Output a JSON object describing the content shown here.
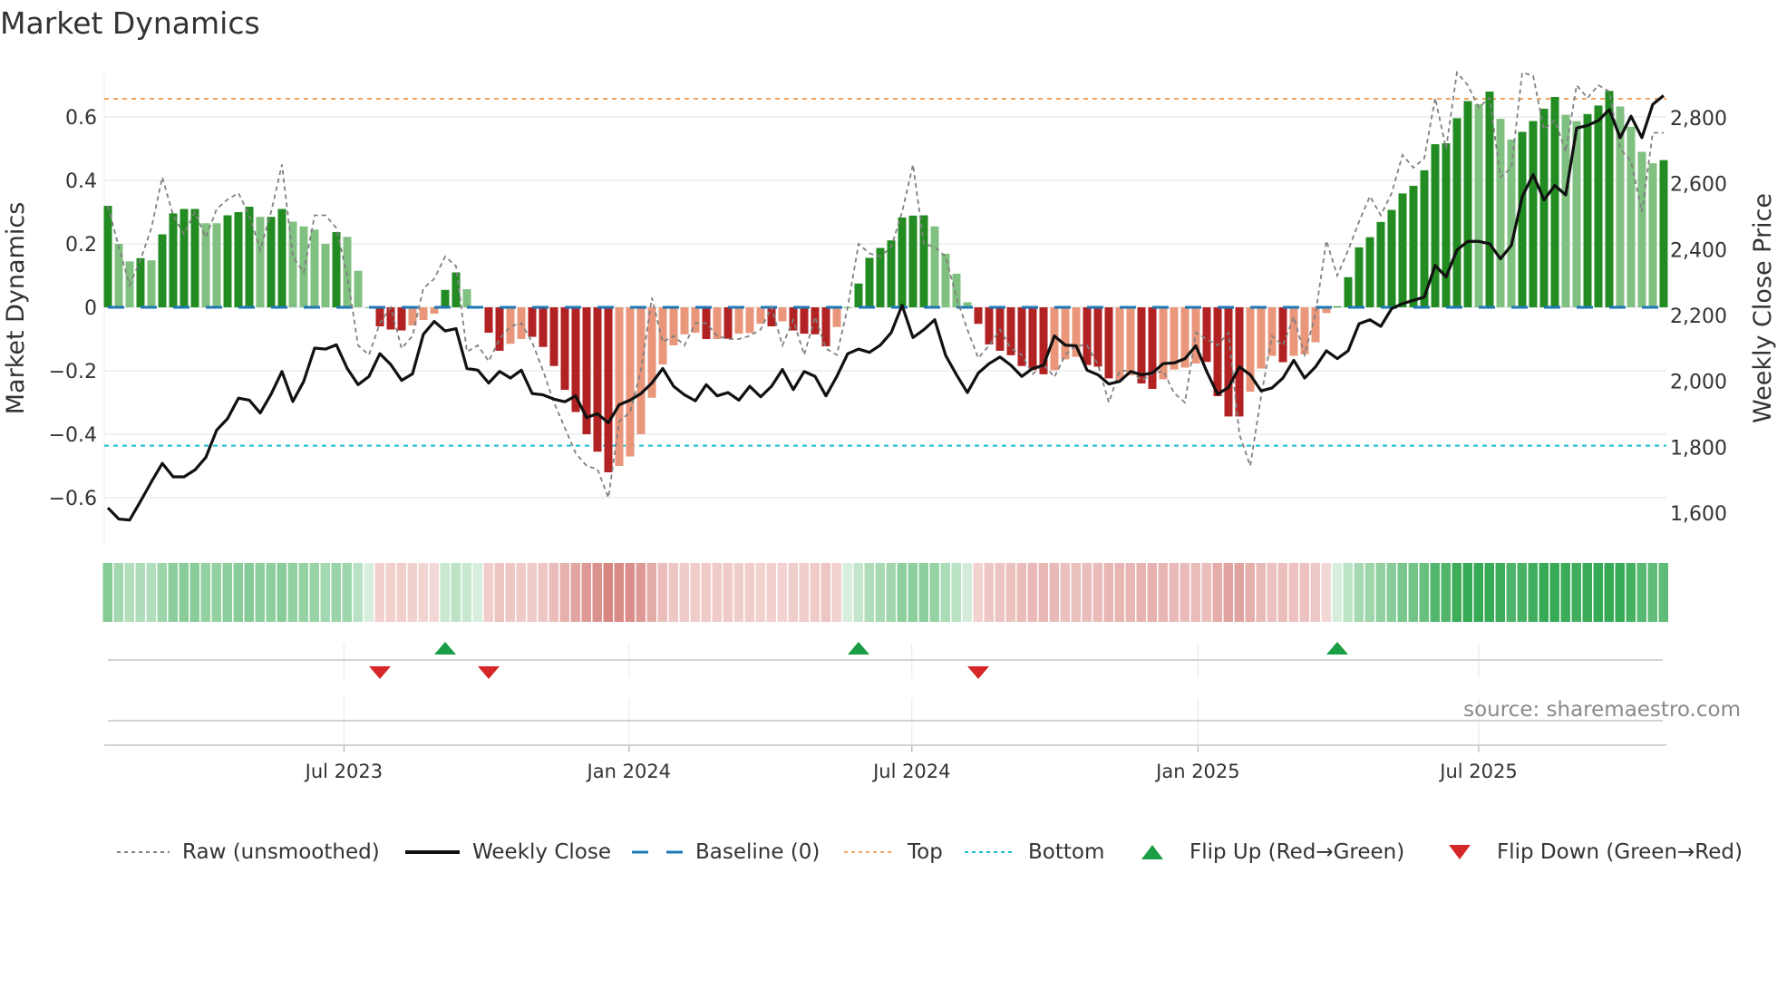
{
  "title": "Market Dynamics",
  "source": "source: sharemaestro.com",
  "colors": {
    "up_strong": "#228b22",
    "up_weak": "#80c080",
    "down_strong": "#b22222",
    "down_weak": "#e9967a",
    "baseline": "#1f77b4",
    "top": "#f4a460",
    "bottom": "#17becf",
    "raw": "#808080",
    "close": "#111111",
    "flip_up": "#1a9e45",
    "flip_down": "#d62728"
  },
  "chart_data": {
    "type": "bar+line",
    "title": "Market Dynamics",
    "ylabel_left": "Market Dynamics",
    "ylabel_right": "Weekly Close Price",
    "ylim_left": [
      -0.72,
      0.75
    ],
    "ylim_right": [
      1550,
      2950
    ],
    "left_ticks": [
      {
        "v": 0.6,
        "label": "0.6"
      },
      {
        "v": 0.4,
        "label": "0.4"
      },
      {
        "v": 0.2,
        "label": "0.2"
      },
      {
        "v": 0,
        "label": "0"
      },
      {
        "v": -0.2,
        "label": "−0.2"
      },
      {
        "v": -0.4,
        "label": "−0.4"
      },
      {
        "v": -0.6,
        "label": "−0.6"
      }
    ],
    "right_ticks": [
      {
        "v": 1600,
        "label": "1,600"
      },
      {
        "v": 1800,
        "label": "1,800"
      },
      {
        "v": 2000,
        "label": "2,000"
      },
      {
        "v": 2200,
        "label": "2,200"
      },
      {
        "v": 2400,
        "label": "2,400"
      },
      {
        "v": 2600,
        "label": "2,600"
      },
      {
        "v": 2800,
        "label": "2,800"
      }
    ],
    "x_ticks": [
      {
        "week": 21.7,
        "label": "Jul 2023"
      },
      {
        "week": 47.9,
        "label": "Jan 2024"
      },
      {
        "week": 73.9,
        "label": "Jul 2024"
      },
      {
        "week": 100.2,
        "label": "Jan 2025"
      },
      {
        "week": 126.0,
        "label": "Jul 2025"
      }
    ],
    "top_level": 0.657,
    "bottom_level": -0.436,
    "baseline": 0,
    "momentum": [
      0.32,
      0.2,
      0.145,
      0.155,
      0.148,
      0.23,
      0.296,
      0.31,
      0.31,
      0.265,
      0.265,
      0.29,
      0.3,
      0.317,
      0.285,
      0.285,
      0.31,
      0.27,
      0.255,
      0.245,
      0.2,
      0.237,
      0.222,
      0.115,
      0.0,
      -0.06,
      -0.07,
      -0.073,
      -0.057,
      -0.04,
      -0.02,
      0.055,
      0.11,
      0.057,
      0.002,
      -0.08,
      -0.137,
      -0.115,
      -0.1,
      -0.093,
      -0.125,
      -0.185,
      -0.26,
      -0.33,
      -0.4,
      -0.455,
      -0.52,
      -0.5,
      -0.47,
      -0.4,
      -0.285,
      -0.18,
      -0.12,
      -0.085,
      -0.08,
      -0.1,
      -0.1,
      -0.099,
      -0.083,
      -0.081,
      -0.052,
      -0.06,
      -0.044,
      -0.073,
      -0.083,
      -0.085,
      -0.123,
      -0.062,
      0.0,
      0.075,
      0.156,
      0.187,
      0.211,
      0.283,
      0.289,
      0.29,
      0.255,
      0.169,
      0.106,
      0.016,
      -0.052,
      -0.117,
      -0.137,
      -0.151,
      -0.185,
      -0.198,
      -0.211,
      -0.198,
      -0.164,
      -0.156,
      -0.182,
      -0.187,
      -0.224,
      -0.229,
      -0.214,
      -0.24,
      -0.257,
      -0.227,
      -0.196,
      -0.19,
      -0.177,
      -0.172,
      -0.28,
      -0.344,
      -0.344,
      -0.266,
      -0.193,
      -0.153,
      -0.173,
      -0.153,
      -0.148,
      -0.11,
      -0.018,
      0.003,
      0.095,
      0.189,
      0.221,
      0.269,
      0.307,
      0.359,
      0.383,
      0.432,
      0.514,
      0.517,
      0.596,
      0.65,
      0.64,
      0.68,
      0.594,
      0.529,
      0.553,
      0.587,
      0.626,
      0.663,
      0.607,
      0.587,
      0.609,
      0.636,
      0.682,
      0.633,
      0.569,
      0.49,
      0.454,
      0.464
    ],
    "strong": [
      1,
      0,
      0,
      1,
      0,
      1,
      1,
      1,
      1,
      0,
      0,
      1,
      1,
      1,
      0,
      1,
      1,
      0,
      0,
      0,
      0,
      1,
      0,
      0,
      0,
      1,
      1,
      1,
      0,
      0,
      0,
      1,
      1,
      0,
      0,
      1,
      1,
      0,
      0,
      1,
      1,
      1,
      1,
      1,
      1,
      1,
      1,
      0,
      0,
      0,
      0,
      0,
      0,
      0,
      0,
      1,
      0,
      1,
      0,
      0,
      0,
      1,
      0,
      1,
      1,
      1,
      1,
      0,
      0,
      1,
      1,
      1,
      1,
      1,
      1,
      1,
      0,
      0,
      0,
      0,
      1,
      1,
      1,
      1,
      1,
      1,
      1,
      0,
      0,
      0,
      1,
      1,
      1,
      0,
      0,
      1,
      1,
      0,
      0,
      0,
      0,
      1,
      1,
      1,
      1,
      0,
      0,
      0,
      1,
      0,
      0,
      0,
      0,
      1,
      1,
      1,
      1,
      1,
      1,
      1,
      1,
      1,
      1,
      1,
      1,
      1,
      0,
      1,
      0,
      0,
      1,
      1,
      1,
      1,
      0,
      0,
      1,
      1,
      1,
      0,
      0,
      0,
      0,
      1
    ],
    "raw": [
      0.32,
      0.19,
      0.07,
      0.15,
      0.25,
      0.41,
      0.29,
      0.23,
      0.3,
      0.22,
      0.31,
      0.34,
      0.36,
      0.29,
      0.18,
      0.3,
      0.45,
      0.16,
      0.11,
      0.29,
      0.29,
      0.25,
      0.1,
      -0.12,
      -0.15,
      -0.05,
      0.0,
      -0.13,
      -0.09,
      0.06,
      0.09,
      0.16,
      0.13,
      -0.14,
      -0.12,
      -0.17,
      -0.1,
      -0.06,
      -0.05,
      -0.11,
      -0.2,
      -0.3,
      -0.38,
      -0.46,
      -0.5,
      -0.51,
      -0.6,
      -0.36,
      -0.33,
      -0.2,
      0.03,
      -0.11,
      -0.09,
      -0.12,
      -0.05,
      -0.05,
      -0.09,
      -0.1,
      -0.1,
      -0.09,
      -0.07,
      0.0,
      -0.12,
      -0.04,
      -0.15,
      -0.03,
      -0.13,
      -0.15,
      0.0,
      0.2,
      0.17,
      0.16,
      0.19,
      0.3,
      0.45,
      0.2,
      0.19,
      0.16,
      0.03,
      -0.07,
      -0.16,
      -0.12,
      -0.07,
      -0.13,
      -0.15,
      -0.21,
      -0.18,
      -0.22,
      -0.15,
      -0.12,
      -0.12,
      -0.18,
      -0.3,
      -0.2,
      -0.2,
      -0.23,
      -0.21,
      -0.2,
      -0.27,
      -0.3,
      -0.08,
      -0.1,
      -0.12,
      -0.08,
      -0.4,
      -0.5,
      -0.28,
      -0.09,
      -0.12,
      -0.03,
      -0.15,
      -0.02,
      0.21,
      0.1,
      0.18,
      0.27,
      0.35,
      0.29,
      0.36,
      0.48,
      0.44,
      0.47,
      0.66,
      0.5,
      0.74,
      0.7,
      0.63,
      0.66,
      0.41,
      0.44,
      0.74,
      0.73,
      0.56,
      0.59,
      0.49,
      0.7,
      0.66,
      0.7,
      0.68,
      0.5,
      0.46,
      0.3,
      0.55,
      0.55
    ],
    "close": [
      1616,
      1582,
      1579,
      1636,
      1695,
      1751,
      1710,
      1710,
      1731,
      1769,
      1852,
      1887,
      1949,
      1943,
      1904,
      1961,
      2030,
      1939,
      2000,
      2101,
      2098,
      2111,
      2039,
      1990,
      2015,
      2084,
      2051,
      2003,
      2023,
      2143,
      2182,
      2153,
      2160,
      2039,
      2034,
      1995,
      2030,
      2010,
      2034,
      1963,
      1959,
      1946,
      1938,
      1956,
      1890,
      1902,
      1874,
      1929,
      1943,
      1963,
      1995,
      2039,
      1985,
      1959,
      1941,
      1990,
      1956,
      1966,
      1943,
      1985,
      1953,
      1985,
      2036,
      1975,
      2030,
      2015,
      1956,
      2015,
      2084,
      2098,
      2088,
      2110,
      2148,
      2231,
      2133,
      2157,
      2187,
      2079,
      2020,
      1966,
      2025,
      2054,
      2074,
      2049,
      2015,
      2039,
      2049,
      2138,
      2110,
      2108,
      2034,
      2020,
      1992,
      2000,
      2030,
      2020,
      2025,
      2054,
      2056,
      2069,
      2108,
      2030,
      1961,
      1982,
      2044,
      2020,
      1971,
      1980,
      2010,
      2064,
      2010,
      2044,
      2093,
      2069,
      2093,
      2175,
      2187,
      2167,
      2221,
      2236,
      2246,
      2256,
      2352,
      2317,
      2399,
      2425,
      2425,
      2418,
      2372,
      2413,
      2561,
      2628,
      2551,
      2595,
      2566,
      2769,
      2777,
      2792,
      2825,
      2740,
      2805,
      2740,
      2841,
      2868
    ],
    "flips_up": [
      31,
      69,
      113
    ],
    "flips_down": [
      25,
      35,
      80
    ]
  },
  "legend": [
    {
      "label": "Raw (unsmoothed)",
      "icon": "dotted-gray-line"
    },
    {
      "label": "Weekly Close",
      "icon": "solid-black-line"
    },
    {
      "label": "Baseline (0)",
      "icon": "dashed-blue-line"
    },
    {
      "label": "Top",
      "icon": "dotted-orange-line"
    },
    {
      "label": "Bottom",
      "icon": "dotted-cyan-line"
    },
    {
      "label": "Flip Up (Red→Green)",
      "icon": "triangle-up-icon"
    },
    {
      "label": "Flip Down (Green→Red)",
      "icon": "triangle-down-icon"
    }
  ]
}
